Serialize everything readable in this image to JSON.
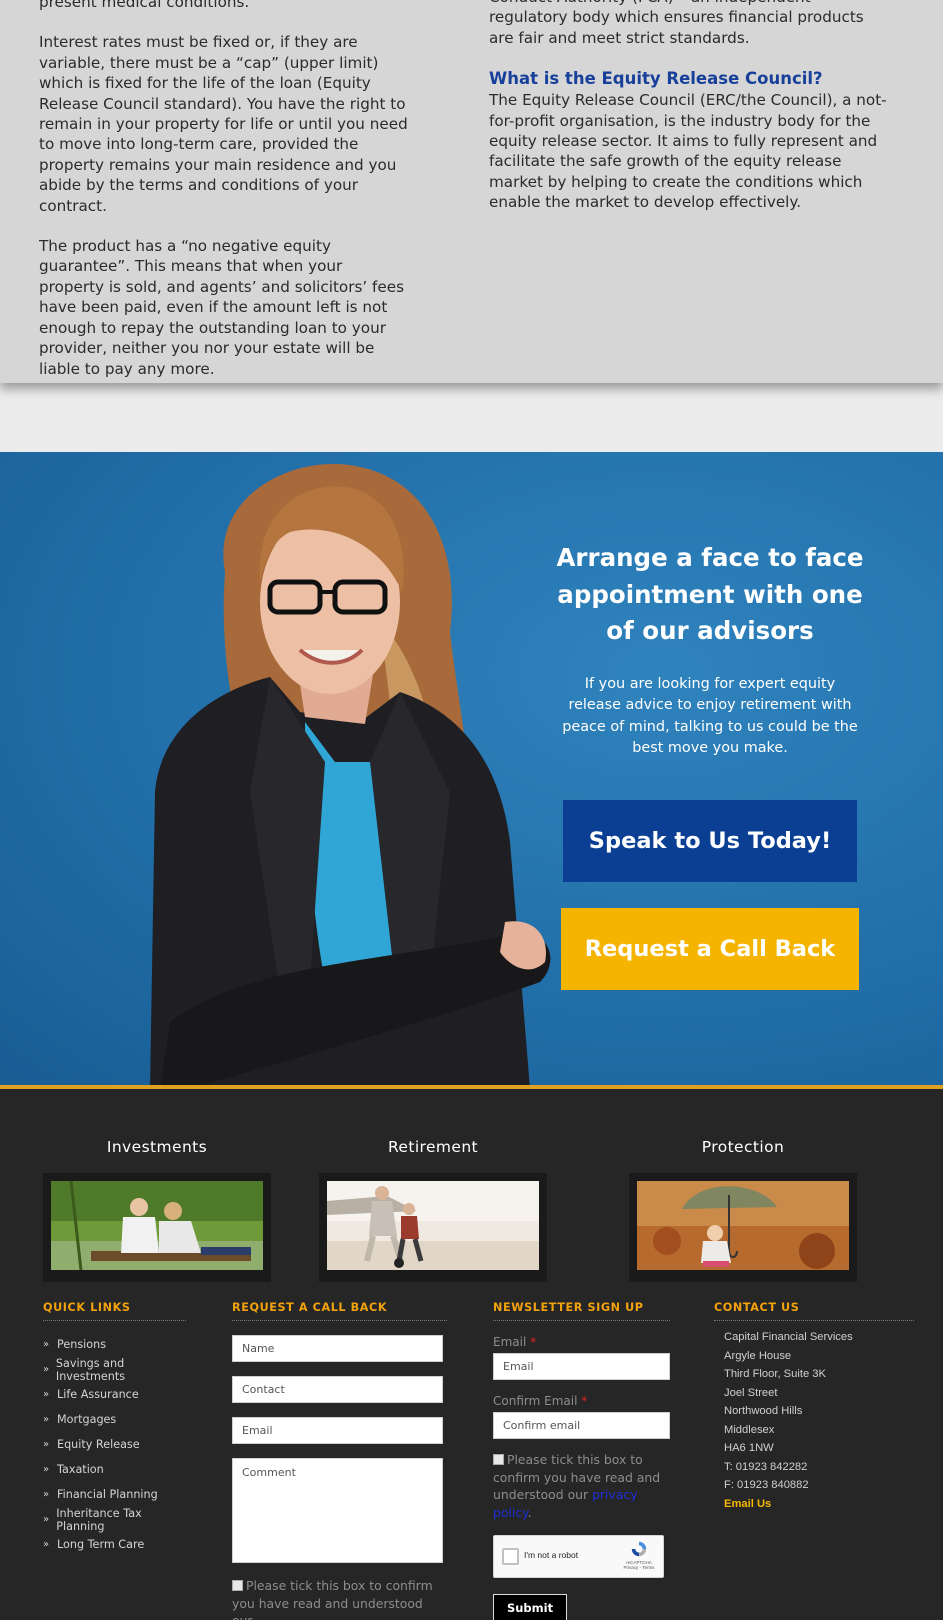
{
  "info": {
    "left_paragraphs": [
      "present medical conditions.",
      "Interest rates must be fixed or, if they are variable, there must be a “cap” (upper limit) which is fixed for the life of the loan (Equity Release Council standard). You have the right to remain in your property for life or until you need to move into long-term care, provided the property remains your main residence and you abide by the terms and conditions of your contract.",
      "The product has a “no negative equity guarantee”. This means that when your property is sold, and agents’ and solicitors’ fees have been paid, even if the amount left is not enough to repay the outstanding loan to your provider, neither you nor your estate will be liable to pay any more."
    ],
    "right_top": "Conduct Authority (FCA) – an independent regulatory body which ensures financial products are fair and meet strict standards.",
    "erc_heading": "What is the Equity Release Council?",
    "erc_text": "The Equity Release Council (ERC/the Council), a not-for-profit organisation, is the industry body for the equity release sector. It aims to fully represent and facilitate the safe growth of the equity release market by helping to create the conditions which enable the market to develop effectively."
  },
  "hero": {
    "heading": "Arrange a face to face appointment with one of our advisors",
    "text": "If you are looking for expert equity release advice to enjoy retirement with peace of mind, talking to us could be the best move you make.",
    "speak_button": "Speak to Us Today!",
    "callback_button": "Request a Call Back",
    "colors": {
      "speak": "#0a3f93",
      "callback": "#f4b400",
      "accent_line": "#e0a020"
    }
  },
  "categories": [
    {
      "title": "Investments",
      "image": "couple-by-lake"
    },
    {
      "title": "Retirement",
      "image": "grandfather-football-beach"
    },
    {
      "title": "Protection",
      "image": "child-with-umbrella"
    }
  ],
  "footer": {
    "quick_links": {
      "heading": "QUICK LINKS",
      "items": [
        "Pensions",
        "Savings and Investments",
        "Life Assurance",
        "Mortgages",
        "Equity Release",
        "Taxation",
        "Financial Planning",
        "Inheritance Tax Planning",
        "Long Term Care"
      ]
    },
    "callback": {
      "heading": "REQUEST A CALL BACK",
      "name_placeholder": "Name",
      "contact_placeholder": "Contact",
      "email_placeholder": "Email",
      "comment_placeholder": "Comment",
      "consent_text": "Please tick this box to confirm you have read and understood our"
    },
    "newsletter": {
      "heading": "NEWSLETTER SIGN UP",
      "email_label": "Email",
      "email_placeholder": "Email",
      "confirm_label": "Confirm Email",
      "confirm_placeholder": "Confirm email",
      "required_mark": "*",
      "consent_text": "Please tick this box to confirm you have read and understood our",
      "privacy_link": "privacy policy",
      "recaptcha_label": "I'm not a robot",
      "recaptcha_brand": "reCAPTCHA",
      "recaptcha_terms": "Privacy - Terms",
      "submit": "Submit"
    },
    "contact": {
      "heading": "CONTACT US",
      "lines": [
        "Capital Financial Services",
        "Argyle House",
        "Third Floor, Suite 3K",
        "Joel Street",
        "Northwood Hills",
        "Middlesex",
        "HA6 1NW",
        "T: 01923 842282",
        "F: 01923 840882"
      ],
      "email_link": "Email Us"
    },
    "accent_color": "#f2a20c"
  }
}
